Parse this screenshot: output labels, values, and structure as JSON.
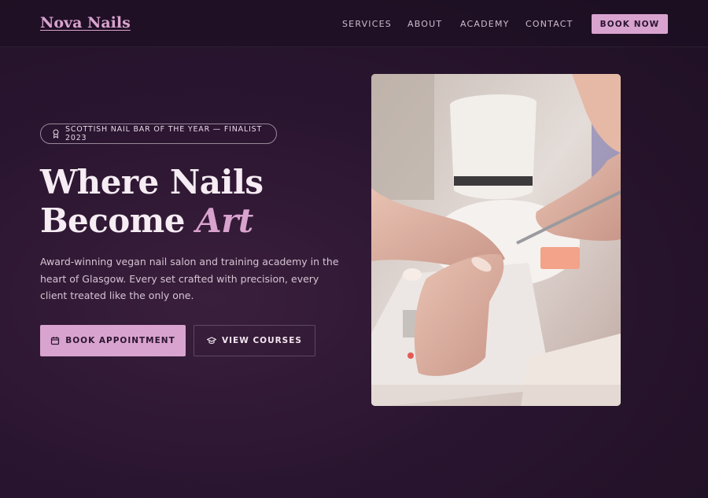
{
  "brand": {
    "name": "Nova Nails"
  },
  "nav": {
    "links": [
      "SERVICES",
      "ABOUT",
      "ACADEMY",
      "CONTACT"
    ],
    "cta": "BOOK NOW"
  },
  "hero": {
    "badge": "SCOTTISH NAIL BAR OF THE YEAR — FINALIST 2023",
    "headline_line1": "Where Nails",
    "headline_line2": "Become",
    "headline_accent": "Art",
    "description": "Award-winning vegan nail salon and training academy in the heart of Glasgow. Every set crafted with precision, every client treated like the only one.",
    "primary_button": "BOOK APPOINTMENT",
    "secondary_button": "VIEW COURSES",
    "image_alt": "Nail technician applying a manicure"
  },
  "colors": {
    "accent": "#d9a3cf",
    "background": "#2a1530",
    "text": "#f3e6f0"
  },
  "icons": {
    "badge": "award-icon",
    "primary_button": "calendar-icon",
    "secondary_button": "graduation-cap-icon"
  }
}
